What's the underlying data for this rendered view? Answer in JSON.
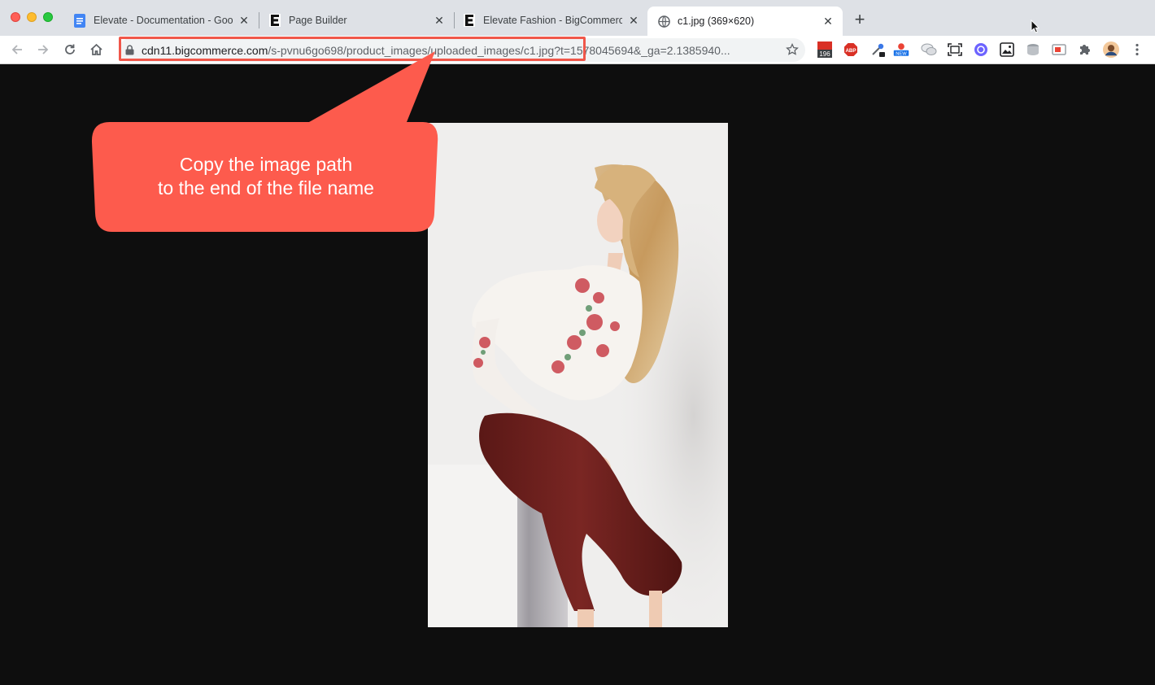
{
  "browser": {
    "tabs": [
      {
        "title": "Elevate - Documentation - Goo",
        "favicon": "google-docs-icon",
        "active": false
      },
      {
        "title": "Page Builder",
        "favicon": "e-logo-icon",
        "active": false
      },
      {
        "title": "Elevate Fashion - BigCommerc",
        "favicon": "e-logo-icon",
        "active": false
      },
      {
        "title": "c1.jpg (369×620)",
        "favicon": "globe-icon",
        "active": true
      }
    ],
    "address": {
      "host": "cdn11.bigcommerce.com",
      "path": "/s-pvnu6go698/product_images/uploaded_images/c1.jpg",
      "query": "?t=1578045694&_ga=2.1385940..."
    },
    "extensions": [
      {
        "name": "calendar-badge-icon",
        "badge": "196"
      },
      {
        "name": "adblock-icon",
        "label": "ABP"
      },
      {
        "name": "eyedropper-icon"
      },
      {
        "name": "extension-new-icon",
        "badge": "NEW"
      },
      {
        "name": "chat-bubbles-icon"
      },
      {
        "name": "screen-capture-icon"
      },
      {
        "name": "circle-extension-icon"
      },
      {
        "name": "image-icon"
      },
      {
        "name": "database-icon"
      },
      {
        "name": "window-icon"
      },
      {
        "name": "puzzle-icon"
      },
      {
        "name": "avatar"
      },
      {
        "name": "kebab-menu-icon"
      }
    ],
    "colors": {
      "accent": "#f0574a",
      "tabstrip": "#dee1e6",
      "page_bg": "#0e0e0e"
    }
  },
  "annotation": {
    "line1": "Copy the image path",
    "line2": "to the end of the file name",
    "color": "#fd5b4d"
  },
  "page": {
    "image_alt": "c1.jpg"
  }
}
